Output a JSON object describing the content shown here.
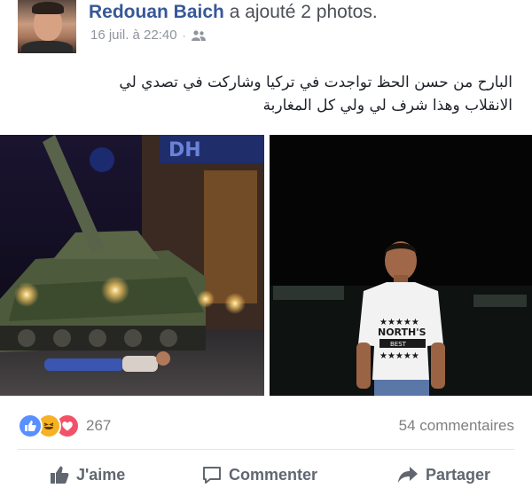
{
  "post": {
    "author": "Redouan Baich",
    "action": "a ajouté 2 photos.",
    "timestamp": "16 juil. à 22:40",
    "separator": "·",
    "audience_icon": "friends-icon",
    "status_line_1": "البارح من حسن الحظ تواجدت في تركيا وشاركت في تصدي لي",
    "status_line_2": "الانقلاب وهذا شرف لي ولي كل المغاربة",
    "photos": [
      {
        "name": "tank-photo",
        "sign_text": "DH"
      },
      {
        "name": "portrait-photo",
        "shirt_text_1": "NORTH'S",
        "shirt_text_2": "BEST"
      }
    ]
  },
  "reactions": {
    "icons": [
      "like-reaction-icon",
      "haha-reaction-icon",
      "love-reaction-icon"
    ],
    "count": "267",
    "comments": "54 commentaires"
  },
  "actions": {
    "like": "J'aime",
    "comment": "Commenter",
    "share": "Partager"
  },
  "colors": {
    "author": "#365899",
    "meta": "#90949c",
    "like_blue": "#5890ff",
    "haha_yellow": "#f7b125",
    "love_red": "#f25268"
  }
}
